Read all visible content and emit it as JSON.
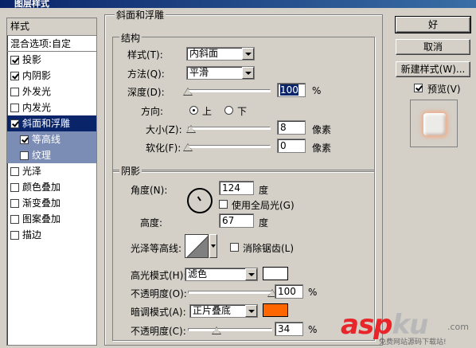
{
  "title": "图层样式",
  "styles": {
    "header": "样式",
    "blend": "混合选项:自定",
    "items": [
      {
        "label": "投影",
        "checked": true
      },
      {
        "label": "内阴影",
        "checked": true
      },
      {
        "label": "外发光",
        "checked": false
      },
      {
        "label": "内发光",
        "checked": false
      },
      {
        "label": "斜面和浮雕",
        "checked": true
      },
      {
        "label": "等高线",
        "checked": true
      },
      {
        "label": "纹理",
        "checked": false
      },
      {
        "label": "光泽",
        "checked": false
      },
      {
        "label": "颜色叠加",
        "checked": false
      },
      {
        "label": "渐变叠加",
        "checked": false
      },
      {
        "label": "图案叠加",
        "checked": false
      },
      {
        "label": "描边",
        "checked": false
      }
    ]
  },
  "bevel": {
    "section_title": "斜面和浮雕",
    "structure_title": "结构",
    "style_label": "样式(T):",
    "style_value": "内斜面",
    "technique_label": "方法(Q):",
    "technique_value": "平滑",
    "depth_label": "深度(D):",
    "depth_value": "100",
    "depth_unit": "%",
    "direction_label": "方向:",
    "direction_up": "上",
    "direction_down": "下",
    "size_label": "大小(Z):",
    "size_value": "8",
    "size_unit": "像素",
    "soften_label": "软化(F):",
    "soften_value": "0",
    "soften_unit": "像素"
  },
  "shading": {
    "title": "阴影",
    "angle_label": "角度(N):",
    "angle_value": "124",
    "angle_unit": "度",
    "global_light_label": "使用全局光(G)",
    "altitude_label": "高度:",
    "altitude_value": "67",
    "altitude_unit": "度",
    "gloss_label": "光泽等高线:",
    "antialias_label": "消除锯齿(L)",
    "highlight_mode_label": "高光模式(H):",
    "highlight_mode_value": "滤色",
    "highlight_color": "#ffffff",
    "highlight_opacity_label": "不透明度(O):",
    "highlight_opacity_value": "100",
    "highlight_opacity_unit": "%",
    "shadow_mode_label": "暗调模式(A):",
    "shadow_mode_value": "正片叠底",
    "shadow_color": "#ff6600",
    "shadow_opacity_label": "不透明度(C):",
    "shadow_opacity_value": "34",
    "shadow_opacity_unit": "%"
  },
  "buttons": {
    "ok": "好",
    "cancel": "取消",
    "new_style": "新建样式(W)...",
    "preview": "预览(V)"
  },
  "sliders": {
    "depth": 0.0,
    "size": 0.04,
    "soften": 0.0,
    "highlight_opacity": 1.0,
    "shadow_opacity": 0.34
  },
  "watermark": {
    "brand_a": "asp",
    "brand_b": "ku",
    "dotcom": ".com",
    "tagline": "免费网站源码下载站!"
  }
}
